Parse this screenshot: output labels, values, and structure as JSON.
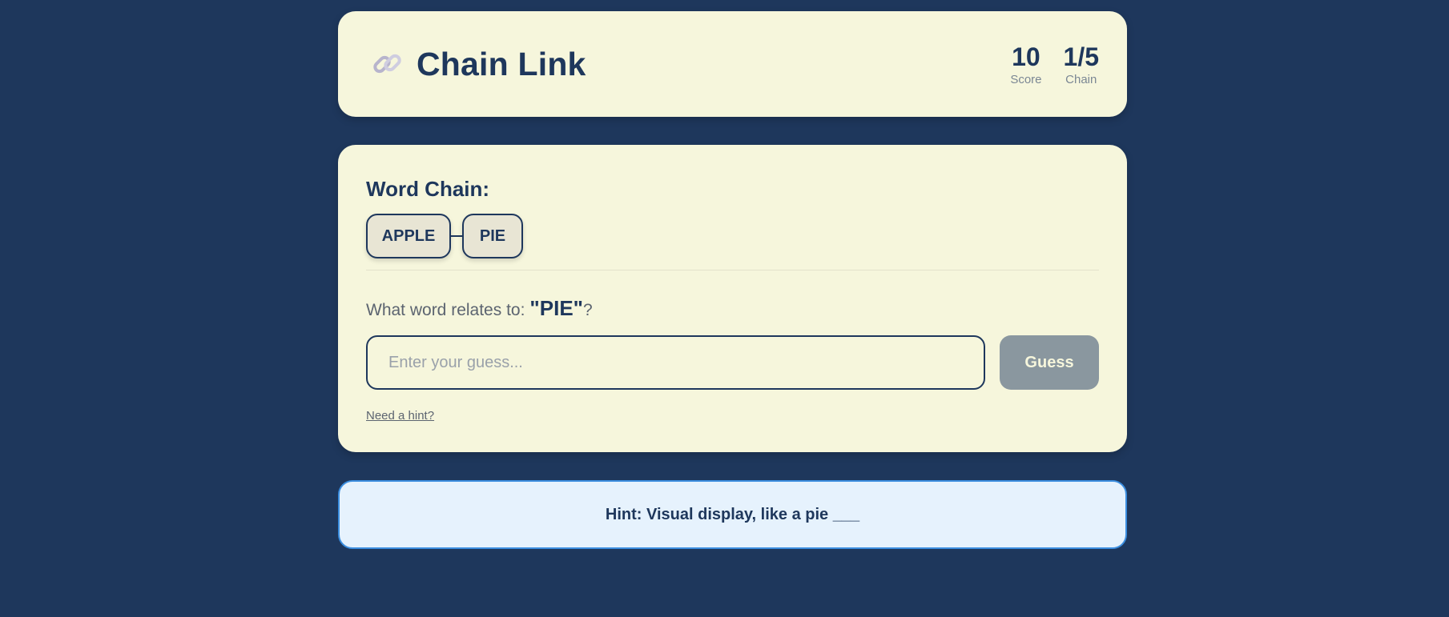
{
  "header": {
    "icon": "chain-link-icon",
    "title": "Chain Link",
    "stats": [
      {
        "value": "10",
        "label": "Score"
      },
      {
        "value": "1/5",
        "label": "Chain"
      }
    ]
  },
  "chain": {
    "title": "Word Chain:",
    "words": [
      "APPLE",
      "PIE"
    ]
  },
  "question": {
    "prefix": "What word relates to:",
    "target": "\"PIE\"",
    "suffix": "?"
  },
  "guess": {
    "placeholder": "Enter your guess...",
    "value": "",
    "button_label": "Guess"
  },
  "hint_link": "Need a hint?",
  "hint_text": "Hint: Visual display, like a pie ___",
  "colors": {
    "background": "#1e375c",
    "card": "#f6f6dc",
    "button_disabled": "#8a979f",
    "hint_border": "#3b8ee0",
    "hint_bg": "#e6f2fd"
  }
}
